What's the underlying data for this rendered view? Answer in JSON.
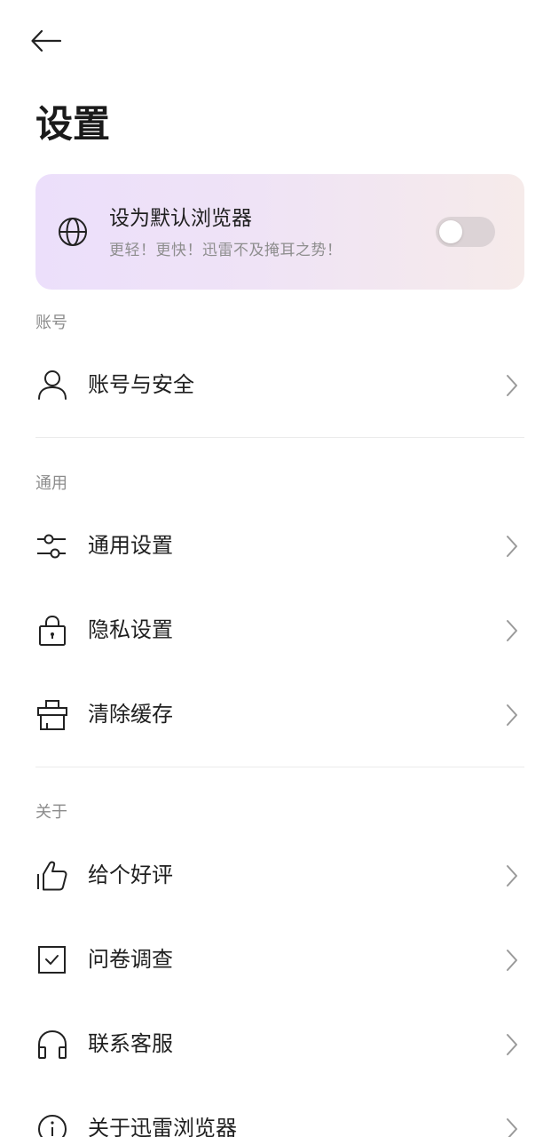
{
  "header": {
    "back_icon": "arrow-left-icon",
    "title": "设置"
  },
  "default_browser_card": {
    "icon": "globe-icon",
    "title": "设为默认浏览器",
    "subtitle": "更轻！更快！迅雷不及掩耳之势！",
    "toggle_on": false
  },
  "sections": {
    "account": {
      "label": "账号",
      "items": [
        {
          "label": "账号与安全",
          "icon": "user-icon"
        }
      ]
    },
    "general": {
      "label": "通用",
      "items": [
        {
          "label": "通用设置",
          "icon": "sliders-icon"
        },
        {
          "label": "隐私设置",
          "icon": "lock-icon"
        },
        {
          "label": "清除缓存",
          "icon": "broom-icon"
        }
      ]
    },
    "about": {
      "label": "关于",
      "items": [
        {
          "label": "给个好评",
          "icon": "thumbs-up-icon"
        },
        {
          "label": "问卷调查",
          "icon": "checkbox-icon"
        },
        {
          "label": "联系客服",
          "icon": "headset-icon"
        },
        {
          "label": "关于迅雷浏览器",
          "icon": "info-icon"
        }
      ]
    }
  },
  "colors": {
    "card_gradient_start": "#ecdffb",
    "card_gradient_end": "#f6ebea",
    "toggle_off": "#dcd3d6",
    "divider": "#ebebeb",
    "secondary_text": "#8c8c8c"
  }
}
